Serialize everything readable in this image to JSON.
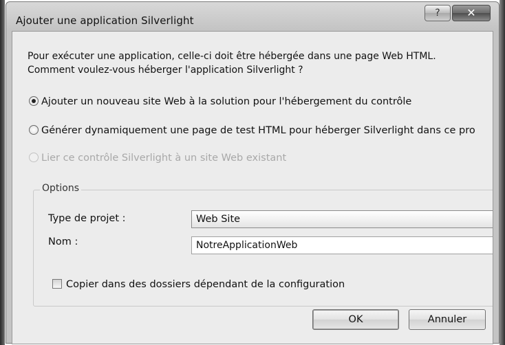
{
  "window": {
    "title": "Ajouter une application Silverlight",
    "help_glyph": "?",
    "close_glyph": "✕"
  },
  "intro": {
    "text": "Pour exécuter une application, celle-ci doit être hébergée dans une page Web HTML. Comment voulez-vous héberger l'application Silverlight ?"
  },
  "options": [
    {
      "label": "Ajouter un nouveau site Web à la solution pour l'hébergement du contrôle",
      "checked": true,
      "enabled": true
    },
    {
      "label": "Générer dynamiquement une page de test HTML pour héberger Silverlight dans ce pro",
      "checked": false,
      "enabled": true
    },
    {
      "label": "Lier ce contrôle Silverlight à un site Web existant",
      "checked": false,
      "enabled": false
    }
  ],
  "group": {
    "legend": "Options",
    "project_type_label": "Type de projet :",
    "project_type_value": "Web Site",
    "name_label": "Nom :",
    "name_value": "NotreApplicationWeb",
    "copy_label": "Copier dans des dossiers dépendant de la configuration",
    "copy_checked": false
  },
  "buttons": {
    "ok": "OK",
    "cancel": "Annuler"
  },
  "icons": {
    "help": "help-icon",
    "close": "close-icon",
    "dropdown": "chevron-down-icon"
  }
}
